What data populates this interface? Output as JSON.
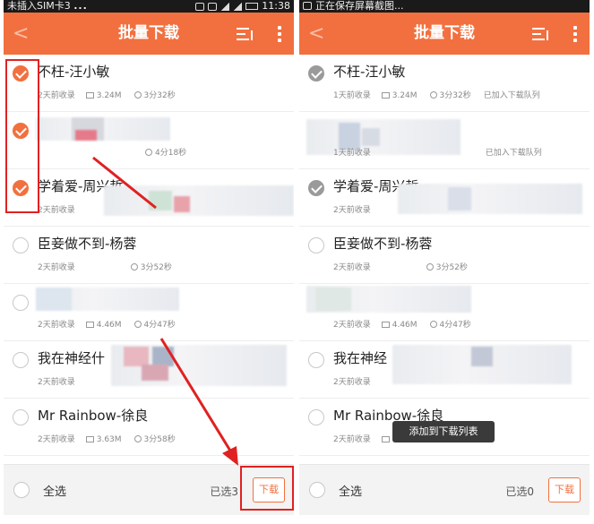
{
  "left_screen": {
    "status": {
      "left": "未插入SIM卡3",
      "dots": "...",
      "time": "11:38"
    },
    "header": {
      "title": "批量下载",
      "back": "<"
    },
    "songs": [
      {
        "title": "不枉-汪小敏",
        "added": "2天前收录",
        "size": "3.24M",
        "duration": "3分32秒",
        "state": "checked"
      },
      {
        "title": "",
        "added": "",
        "size": "",
        "duration": "4分18秒",
        "state": "checked",
        "obscured": true
      },
      {
        "title": "学着爱-周兴哲",
        "added": "2天前收录",
        "size": "",
        "duration": "",
        "state": "checked"
      },
      {
        "title": "臣妾做不到-杨蓉",
        "added": "2天前收录",
        "size": "",
        "duration": "3分52秒",
        "state": "unchecked"
      },
      {
        "title": "",
        "added": "2天前收录",
        "size": "4.46M",
        "duration": "4分47秒",
        "state": "unchecked",
        "obscured": true
      },
      {
        "title": "我在神经什",
        "added": "2天前收录",
        "size": "",
        "duration": "",
        "state": "unchecked"
      },
      {
        "title": "Mr Rainbow-徐良",
        "added": "2天前收录",
        "size": "3.63M",
        "duration": "3分58秒",
        "state": "unchecked"
      }
    ],
    "footer": {
      "select_all": "全选",
      "selected": "已选3",
      "download": "下载"
    }
  },
  "right_screen": {
    "status": {
      "left": "正在保存屏幕截图..."
    },
    "header": {
      "title": "批量下载",
      "back": "<"
    },
    "songs": [
      {
        "title": "不枉-汪小敏",
        "added": "1天前收录",
        "size": "3.24M",
        "duration": "3分32秒",
        "queued": "已加入下载队列",
        "state": "done"
      },
      {
        "title": "",
        "added": "1天前收录",
        "size": "",
        "duration": "",
        "queued": "已加入下载队列",
        "state": "done",
        "obscured": true
      },
      {
        "title": "学着爱-周兴哲",
        "added": "2天前收录",
        "size": "",
        "duration": "",
        "queued": "",
        "state": "done"
      },
      {
        "title": "臣妾做不到-杨蓉",
        "added": "2天前收录",
        "size": "",
        "duration": "3分52秒",
        "queued": "",
        "state": "unchecked"
      },
      {
        "title": "",
        "added": "2天前收录",
        "size": "4.46M",
        "duration": "4分47秒",
        "queued": "",
        "state": "unchecked",
        "obscured": true
      },
      {
        "title": "我在神经",
        "added": "2天前收录",
        "size": "",
        "duration": "",
        "queued": "",
        "state": "unchecked"
      },
      {
        "title": "Mr Rainbow-徐良",
        "added": "2天前收录",
        "size": "3.63M",
        "duration": "3分58秒",
        "queued": "",
        "state": "unchecked"
      }
    ],
    "toast": "添加到下载列表",
    "footer": {
      "select_all": "全选",
      "selected": "已选0",
      "download": "下载"
    }
  },
  "colors": {
    "accent": "#f2703f",
    "annotation_red": "#e02121",
    "done_gray": "#9a9a9a"
  },
  "icons": [
    "back-chevron-icon",
    "download-list-icon",
    "more-vertical-icon",
    "folder-icon",
    "clock-icon",
    "check-icon"
  ]
}
